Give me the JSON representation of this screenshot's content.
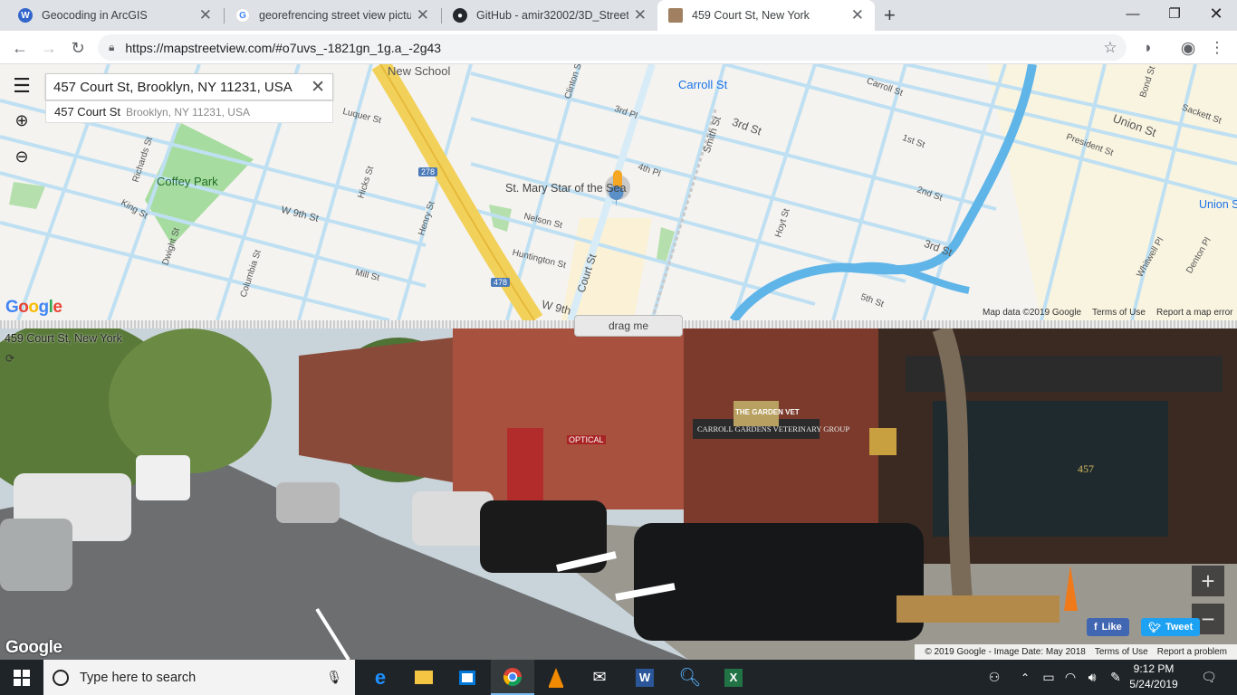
{
  "browser": {
    "tabs": [
      {
        "title": "Geocoding in ArcGIS",
        "icon": "wikipedia-icon"
      },
      {
        "title": "georefrencing street view picture",
        "icon": "google-icon"
      },
      {
        "title": "GitHub - amir32002/3D_Street_V",
        "icon": "github-icon"
      },
      {
        "title": "459 Court St, New York",
        "icon": "streetview-icon",
        "active": true
      }
    ],
    "url": "https://mapstreetview.com/#o7uvs_-1821gn_1g.a_-2g43"
  },
  "map": {
    "search_value": "457 Court St, Brooklyn, NY 11231, USA",
    "suggestion_main": "457 Court St",
    "suggestion_secondary": "Brooklyn, NY 11231, USA",
    "labels": {
      "new_school": "New School",
      "carroll_st_station": "Carroll St",
      "coffey_park": "Coffey Park",
      "st_mary": "St. Mary Star of the Sea",
      "union_st": "Union St",
      "union_st_right": "Union S",
      "court_st": "Court St",
      "w9th": "W 9th St",
      "w9th_bottom": "W 9th",
      "smith_st": "Smith St",
      "third_st": "3rd St",
      "third_st_lower": "3rd St",
      "president_st": "President St",
      "carroll_st": "Carroll St",
      "hoyt_st": "Hoyt St",
      "nelson_st": "Nelson St",
      "huntington_st": "Huntington St",
      "luquer_st": "Luquer St",
      "mill_st": "Mill St",
      "richards_st": "Richards St",
      "king_st": "King St",
      "dwight_st": "Dwight St",
      "columbia_st": "Columbia St",
      "hicks_st": "Hicks St",
      "henry_st": "Henry St",
      "clinton_st": "Clinton St",
      "fifth_st": "5th St",
      "first_st": "1st St",
      "second_st": "2nd St",
      "fourth_pl": "4th Pl",
      "third_pl": "3rd Pl",
      "bond_st": "Bond St",
      "sackett_st": "Sackett St",
      "whitwell_pl": "Whitwell Pl",
      "denton_pl": "Denton Pl",
      "i278": "278",
      "i478": "478"
    },
    "logo": "Google",
    "footer": {
      "map_data": "Map data ©2019 Google",
      "terms": "Terms of Use",
      "report": "Report a map error"
    }
  },
  "drag_label": "drag me",
  "streetview": {
    "address": "459 Court St, New York",
    "logo": "Google",
    "like": "Like",
    "tweet": "Tweet",
    "footer": {
      "copyright": "© 2019 Google - Image Date: May 2018",
      "terms": "Terms of Use",
      "report": "Report a problem"
    },
    "signs": {
      "vet_top": "THE GARDEN VET",
      "vet_band": "CARROLL GARDENS VETERINARY GROUP",
      "optical": "OPTICAL",
      "number": "457"
    }
  },
  "taskbar": {
    "search_placeholder": "Type here to search",
    "time": "9:12 PM",
    "date": "5/24/2019"
  },
  "colors": {
    "map_background": "#f4f3f0",
    "road": "#b9dcef",
    "highway": "#f2d15a",
    "park": "#a7dca0",
    "water": "#5fb4e8",
    "taskbar": "#1f2428",
    "facebook": "#4267b2",
    "twitter": "#1da1f2"
  }
}
